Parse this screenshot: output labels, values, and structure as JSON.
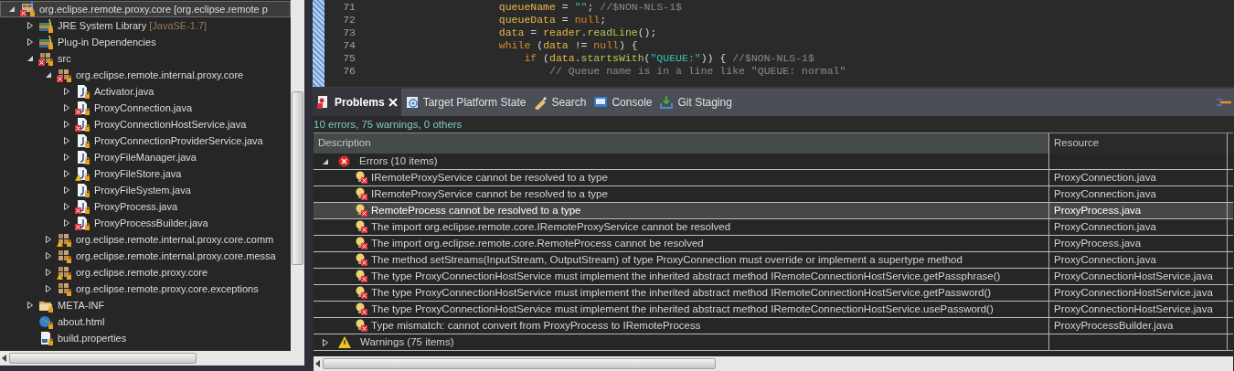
{
  "tree": [
    {
      "label": "org.eclipse.remote.proxy.core [org.eclipse.remote p",
      "kind": "project",
      "error": true,
      "warning": false,
      "expanded": true,
      "selected": true,
      "children": [
        {
          "label": "JRE System Library",
          "decoration": "[JavaSE-1.7]",
          "kind": "library",
          "error": false,
          "warning": false,
          "expanded": false,
          "selected": false
        },
        {
          "label": "Plug-in Dependencies",
          "kind": "library",
          "error": false,
          "warning": false,
          "expanded": false,
          "selected": false
        },
        {
          "label": "src",
          "kind": "sourcefolder",
          "error": true,
          "warning": false,
          "expanded": true,
          "selected": false,
          "children": [
            {
              "label": "org.eclipse.remote.internal.proxy.core",
              "kind": "package",
              "error": true,
              "warning": false,
              "expanded": true,
              "selected": false,
              "children": [
                {
                  "label": "Activator.java",
                  "kind": "java",
                  "error": false,
                  "warning": false,
                  "expanded": false,
                  "selected": false
                },
                {
                  "label": "ProxyConnection.java",
                  "kind": "java",
                  "error": true,
                  "warning": false,
                  "expanded": false,
                  "selected": false
                },
                {
                  "label": "ProxyConnectionHostService.java",
                  "kind": "java",
                  "error": true,
                  "warning": false,
                  "expanded": false,
                  "selected": false
                },
                {
                  "label": "ProxyConnectionProviderService.java",
                  "kind": "java",
                  "error": false,
                  "warning": false,
                  "expanded": false,
                  "selected": false
                },
                {
                  "label": "ProxyFileManager.java",
                  "kind": "java",
                  "error": false,
                  "warning": false,
                  "expanded": false,
                  "selected": false
                },
                {
                  "label": "ProxyFileStore.java",
                  "kind": "java",
                  "error": false,
                  "warning": true,
                  "expanded": false,
                  "selected": false
                },
                {
                  "label": "ProxyFileSystem.java",
                  "kind": "java",
                  "error": false,
                  "warning": false,
                  "expanded": false,
                  "selected": false
                },
                {
                  "label": "ProxyProcess.java",
                  "kind": "java",
                  "error": true,
                  "warning": false,
                  "expanded": false,
                  "selected": false
                },
                {
                  "label": "ProxyProcessBuilder.java",
                  "kind": "java",
                  "error": true,
                  "warning": false,
                  "expanded": false,
                  "selected": false
                }
              ]
            },
            {
              "label": "org.eclipse.remote.internal.proxy.core.comm",
              "kind": "package",
              "error": false,
              "warning": true,
              "expanded": false,
              "selected": false
            },
            {
              "label": "org.eclipse.remote.internal.proxy.core.messa",
              "kind": "package",
              "error": false,
              "warning": false,
              "expanded": false,
              "selected": false
            },
            {
              "label": "org.eclipse.remote.proxy.core",
              "kind": "package",
              "error": false,
              "warning": true,
              "expanded": false,
              "selected": false
            },
            {
              "label": "org.eclipse.remote.proxy.core.exceptions",
              "kind": "package",
              "error": false,
              "warning": false,
              "expanded": false,
              "selected": false
            }
          ]
        },
        {
          "label": "META-INF",
          "kind": "folder",
          "error": false,
          "warning": false,
          "expanded": false,
          "selected": false
        },
        {
          "label": "about.html",
          "kind": "html",
          "error": false,
          "warning": false,
          "selected": false
        },
        {
          "label": "build.properties",
          "kind": "properties",
          "error": false,
          "warning": false,
          "selected": false
        }
      ]
    }
  ],
  "editor": {
    "lines": [
      {
        "number": "71",
        "tokens": [
          {
            "text": "            queueName",
            "kind": "field"
          },
          {
            "text": " = ",
            "kind": "plain"
          },
          {
            "text": "\"\"",
            "kind": "string"
          },
          {
            "text": "; ",
            "kind": "plain"
          },
          {
            "text": "//$NON-NLS-1$",
            "kind": "comment"
          }
        ]
      },
      {
        "number": "72",
        "tokens": [
          {
            "text": "            queueData",
            "kind": "field"
          },
          {
            "text": " = ",
            "kind": "plain"
          },
          {
            "text": "null",
            "kind": "keyword"
          },
          {
            "text": ";",
            "kind": "plain"
          }
        ]
      },
      {
        "number": "73",
        "tokens": [
          {
            "text": "            data",
            "kind": "field"
          },
          {
            "text": " = ",
            "kind": "plain"
          },
          {
            "text": "reader",
            "kind": "field"
          },
          {
            "text": ".",
            "kind": "plain"
          },
          {
            "text": "readLine",
            "kind": "method"
          },
          {
            "text": "();",
            "kind": "plain"
          }
        ]
      },
      {
        "number": "74",
        "tokens": [
          {
            "text": "            while",
            "kind": "keyword"
          },
          {
            "text": " (",
            "kind": "plain"
          },
          {
            "text": "data",
            "kind": "field"
          },
          {
            "text": " != ",
            "kind": "plain"
          },
          {
            "text": "null",
            "kind": "keyword"
          },
          {
            "text": ") {",
            "kind": "plain"
          }
        ]
      },
      {
        "number": "75",
        "tokens": [
          {
            "text": "                if",
            "kind": "keyword"
          },
          {
            "text": " (",
            "kind": "plain"
          },
          {
            "text": "data",
            "kind": "field"
          },
          {
            "text": ".",
            "kind": "plain"
          },
          {
            "text": "startsWith",
            "kind": "method"
          },
          {
            "text": "(",
            "kind": "plain"
          },
          {
            "text": "\"QUEUE:\"",
            "kind": "string"
          },
          {
            "text": ")) { ",
            "kind": "plain"
          },
          {
            "text": "//$NON-NLS-1$",
            "kind": "comment"
          }
        ]
      },
      {
        "number": "76",
        "tokens": [
          {
            "text": "                    // Queue name is in a line like \"QUEUE: normal\"",
            "kind": "comment"
          }
        ]
      }
    ]
  },
  "panel": {
    "tabs": [
      {
        "label": "Problems",
        "kind": "problems",
        "selected": true
      },
      {
        "label": "Target Platform State",
        "kind": "target",
        "selected": false
      },
      {
        "label": "Search",
        "kind": "search",
        "selected": false
      },
      {
        "label": "Console",
        "kind": "console",
        "selected": false
      },
      {
        "label": "Git Staging",
        "kind": "git",
        "selected": false
      }
    ],
    "summary": "10 errors, 75 warnings, 0 others",
    "columns": [
      "Description",
      "Resource"
    ],
    "groups": [
      {
        "label": "Errors (10 items)",
        "kind": "error",
        "expanded": true,
        "rows": [
          {
            "description": "IRemoteProxyService cannot be resolved to a type",
            "resource": "ProxyConnection.java",
            "selected": false
          },
          {
            "description": "IRemoteProxyService cannot be resolved to a type",
            "resource": "ProxyConnection.java",
            "selected": false
          },
          {
            "description": "RemoteProcess cannot be resolved to a type",
            "resource": "ProxyProcess.java",
            "selected": true
          },
          {
            "description": "The import org.eclipse.remote.core.IRemoteProxyService cannot be resolved",
            "resource": "ProxyConnection.java",
            "selected": false
          },
          {
            "description": "The import org.eclipse.remote.core.RemoteProcess cannot be resolved",
            "resource": "ProxyProcess.java",
            "selected": false
          },
          {
            "description": "The method setStreams(InputStream, OutputStream) of type ProxyConnection must override or implement a supertype method",
            "resource": "ProxyConnection.java",
            "selected": false
          },
          {
            "description": "The type ProxyConnectionHostService must implement the inherited abstract method IRemoteConnectionHostService.getPassphrase()",
            "resource": "ProxyConnectionHostService.java",
            "selected": false
          },
          {
            "description": "The type ProxyConnectionHostService must implement the inherited abstract method IRemoteConnectionHostService.getPassword()",
            "resource": "ProxyConnectionHostService.java",
            "selected": false
          },
          {
            "description": "The type ProxyConnectionHostService must implement the inherited abstract method IRemoteConnectionHostService.usePassword()",
            "resource": "ProxyConnectionHostService.java",
            "selected": false
          },
          {
            "description": "Type mismatch: cannot convert from ProxyProcess to IRemoteProcess",
            "resource": "ProxyProcessBuilder.java",
            "selected": false
          }
        ]
      },
      {
        "label": "Warnings (75 items)",
        "kind": "warning",
        "expanded": false
      }
    ]
  }
}
